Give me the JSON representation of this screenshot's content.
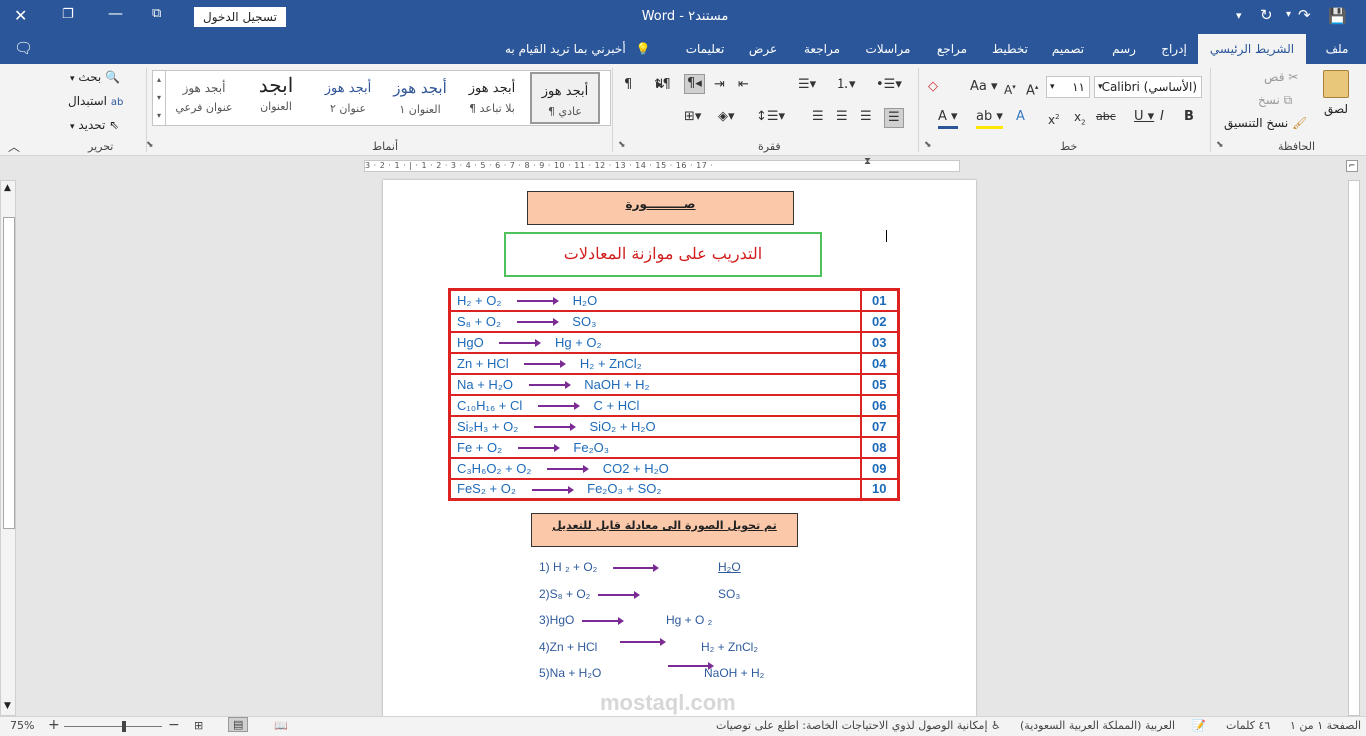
{
  "titlebar": {
    "title": "مستند٢",
    "separator": "-",
    "app_name": "Word",
    "signin_label": "تسجيل الدخول"
  },
  "tabs": [
    "ملف",
    "الشريط الرئيسي",
    "إدراج",
    "رسم",
    "تصميم",
    "تخطيط",
    "مراجع",
    "مراسلات",
    "مراجعة",
    "عرض",
    "تعليمات"
  ],
  "tell_me": "أخبرني بما تريد القيام به",
  "ribbon": {
    "clipboard": {
      "paste": "لصق",
      "cut": "قص",
      "copy": "نسخ",
      "format_painter": "نسخ التنسيق",
      "label": "الحافظة"
    },
    "font": {
      "name": "Calibri (الأساسي)",
      "size": "١١",
      "label": "خط"
    },
    "paragraph": {
      "label": "فقرة"
    },
    "styles": {
      "label": "أنماط",
      "items": [
        {
          "preview": "أبجد هوز",
          "name": "¶ عادي"
        },
        {
          "preview": "أبجد هوز",
          "name": "¶ بلا تباعد"
        },
        {
          "preview": "أبجد هوز",
          "name": "العنوان ١"
        },
        {
          "preview": "أبجد هوز",
          "name": "عنوان ٢"
        },
        {
          "preview": "ابجد",
          "name": "العنوان"
        },
        {
          "preview": "أبجد هوز",
          "name": "عنوان فرعي"
        }
      ]
    },
    "editing": {
      "find": "بحث",
      "replace": "استبدال",
      "select": "تحديد",
      "label": "تحرير"
    }
  },
  "ruler_text": "3 · 2 · 1 · | · 1 · 2 · 3 · 4 · 5 · 6 · 7 · 8 · 9 · 10 · 11 · 12 · 13 · 14 · 15 · 16 · 17 ·",
  "document": {
    "title_box": "صـــــــــورة",
    "image_heading": "التدريب على موازنة المعادلات",
    "table_rows": [
      {
        "num": "01",
        "left": "H₂ + O₂",
        "right": "H₂O"
      },
      {
        "num": "02",
        "left": "S₈ + O₂",
        "right": "SO₃"
      },
      {
        "num": "03",
        "left": "HgO",
        "right": "Hg + O₂"
      },
      {
        "num": "04",
        "left": "Zn + HCl",
        "right": "H₂ + ZnCl₂"
      },
      {
        "num": "05",
        "left": "Na + H₂O",
        "right": "NaOH + H₂"
      },
      {
        "num": "06",
        "left": "C₁₀H₁₆ + Cl",
        "right": "C + HCl"
      },
      {
        "num": "07",
        "left": "Si₂H₃ + O₂",
        "right": "SiO₂ + H₂O"
      },
      {
        "num": "08",
        "left": "Fe + O₂",
        "right": "Fe₂O₃"
      },
      {
        "num": "09",
        "left": "C₃H₆O₂ + O₂",
        "right": "CO2 + H₂O"
      },
      {
        "num": "10",
        "left": "FeS₂ + O₂",
        "right": "Fe₂O₃ + SO₂"
      }
    ],
    "converted_box": "تم تحويل الصورة الى معادلة قابل للتعديل",
    "equations": [
      {
        "left": "1) H ₂ + O₂",
        "right": "H₂O"
      },
      {
        "left": "2)S₈ + O₂",
        "right": "SO₃"
      },
      {
        "left": "3)HgO",
        "right": "Hg + O ₂"
      },
      {
        "left": "4)Zn + HCl",
        "right": "H₂ + ZnCl₂"
      },
      {
        "left": "5)Na + H₂O",
        "right": "NaOH + H₂"
      }
    ],
    "watermark": "mostaql.com"
  },
  "status": {
    "page": "الصفحة ١ من ١",
    "words": "٤٦ كلمات",
    "language": "العربية (المملكة العربية السعودية)",
    "accessibility": "إمكانية الوصول لذوي الاحتياجات الخاصة: اطلع على توصيات",
    "zoom": "75%"
  },
  "colors": {
    "brand": "#2b579a",
    "table_red": "#dd2222",
    "box_peach": "#fbc9aa",
    "arrow_purple": "#7b2b93"
  }
}
